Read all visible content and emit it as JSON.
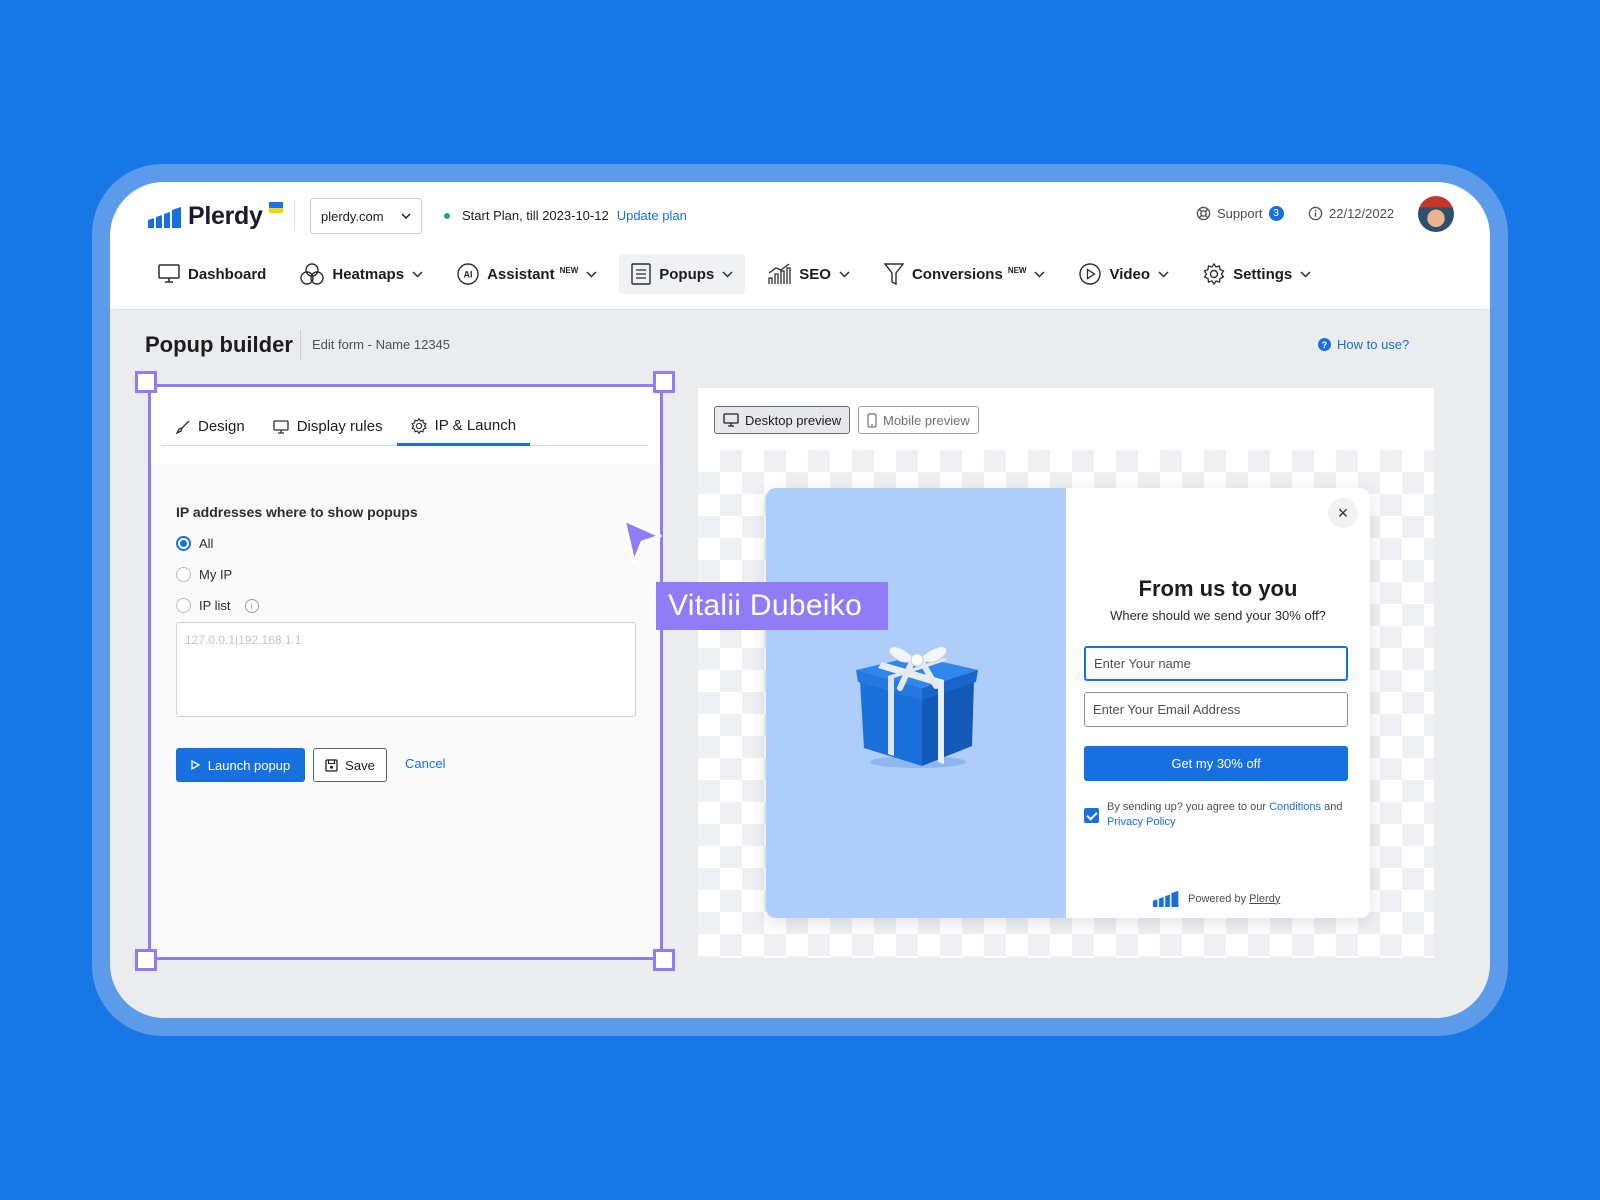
{
  "header": {
    "logo_text": "Plerdy",
    "domain": "plerdy.com",
    "plan_text": "Start Plan, till 2023-10-12",
    "update_plan": "Update plan",
    "support": "Support",
    "support_count": "3",
    "date": "22/12/2022"
  },
  "nav": {
    "items": [
      {
        "label": "Dashboard",
        "icon": "monitor-icon"
      },
      {
        "label": "Heatmaps",
        "icon": "circles-icon"
      },
      {
        "label": "Assistant",
        "badge": "NEW",
        "icon": "ai-icon"
      },
      {
        "label": "Popups",
        "icon": "document-icon"
      },
      {
        "label": "SEO",
        "icon": "bar-chart-icon"
      },
      {
        "label": "Conversions",
        "badge": "NEW",
        "icon": "funnel-icon"
      },
      {
        "label": "Video",
        "icon": "play-icon"
      },
      {
        "label": "Settings",
        "icon": "gear-icon"
      }
    ]
  },
  "page": {
    "title": "Popup builder",
    "subtitle": "Edit form - Name 12345",
    "how_to": "How to use?"
  },
  "editor": {
    "tabs": [
      {
        "label": "Design",
        "icon": "brush-icon"
      },
      {
        "label": "Display rules",
        "icon": "monitor-icon"
      },
      {
        "label": "IP & Launch",
        "icon": "gear-icon",
        "active": true
      }
    ],
    "ip_heading": "IP addresses where to show popups",
    "options": [
      {
        "label": "All",
        "checked": true
      },
      {
        "label": "My IP",
        "checked": false
      },
      {
        "label": "IP list",
        "checked": false
      }
    ],
    "ip_placeholder": "127.0.0.1|192.168.1.1",
    "launch": "Launch popup",
    "save": "Save",
    "cancel": "Cancel"
  },
  "annotation": {
    "name": "Vitalii Dubeiko",
    "accent": "#8f7cf6"
  },
  "preview": {
    "desktop": "Desktop preview",
    "mobile": "Mobile preview",
    "popup": {
      "title": "From us to you",
      "subtitle": "Where should we send your 30% off?",
      "name_placeholder": "Enter Your name",
      "email_placeholder": "Enter Your Email Address",
      "button": "Get my 30% off",
      "consent_prefix": "By sending up? you agree to our ",
      "conditions": "Conditions",
      "consent_and": " and ",
      "privacy": "Privacy Policy",
      "powered_by": "Powered by ",
      "powered_brand": "Plerdy"
    }
  },
  "colors": {
    "background": "#1777e6",
    "primary": "#1770e0",
    "popup_image_bg": "#aecdfb"
  }
}
